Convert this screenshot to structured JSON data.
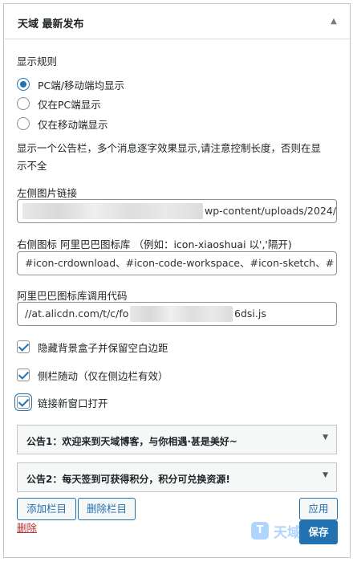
{
  "widget": {
    "title": "天域 最新发布",
    "toggle_icon": "triangle-up"
  },
  "display_rule": {
    "label": "显示规则",
    "options": [
      {
        "label": "PC端/移动端均显示",
        "checked": true
      },
      {
        "label": "仅在PC端显示",
        "checked": false
      },
      {
        "label": "仅在移动端显示",
        "checked": false
      }
    ],
    "description_line1": "显示一个公告栏，多个消息逐字效果显示,请注意控制长度，否则在显",
    "description_line2": "示不全"
  },
  "left_image": {
    "label": "左侧图片链接",
    "value_visible": "wp-content/uploads/2024/"
  },
  "right_icon": {
    "label": "右侧图标 阿里巴巴图标库 （例如：icon-xiaoshuai 以','隔开)",
    "value": "#icon-crdownload、#icon-code-workspace、#icon-sketch、#"
  },
  "iconfont_code": {
    "label": "阿里巴巴图标库调用代码",
    "value_prefix": "//at.alicdn.com/t/c/fo",
    "value_suffix": "6dsi.js"
  },
  "checkboxes": [
    {
      "label": "隐藏背景盒子并保留空白边距",
      "checked": true
    },
    {
      "label": "侧栏随动（仅在侧边栏有效）",
      "checked": true
    },
    {
      "label": "链接新窗口打开",
      "checked": true
    }
  ],
  "announcements": [
    {
      "title": "公告1：欢迎来到天域博客，与你相遇·甚是美好~"
    },
    {
      "title": "公告2：每天签到可获得积分，积分可兑换资源!"
    }
  ],
  "buttons": {
    "add": "添加栏目",
    "remove": "删除栏目",
    "apply": "应用",
    "save": "保存",
    "delete": "删除"
  },
  "watermark": {
    "mark": "T",
    "text": "天域"
  },
  "colors": {
    "accent": "#2271b1",
    "danger": "#b32d2e"
  }
}
